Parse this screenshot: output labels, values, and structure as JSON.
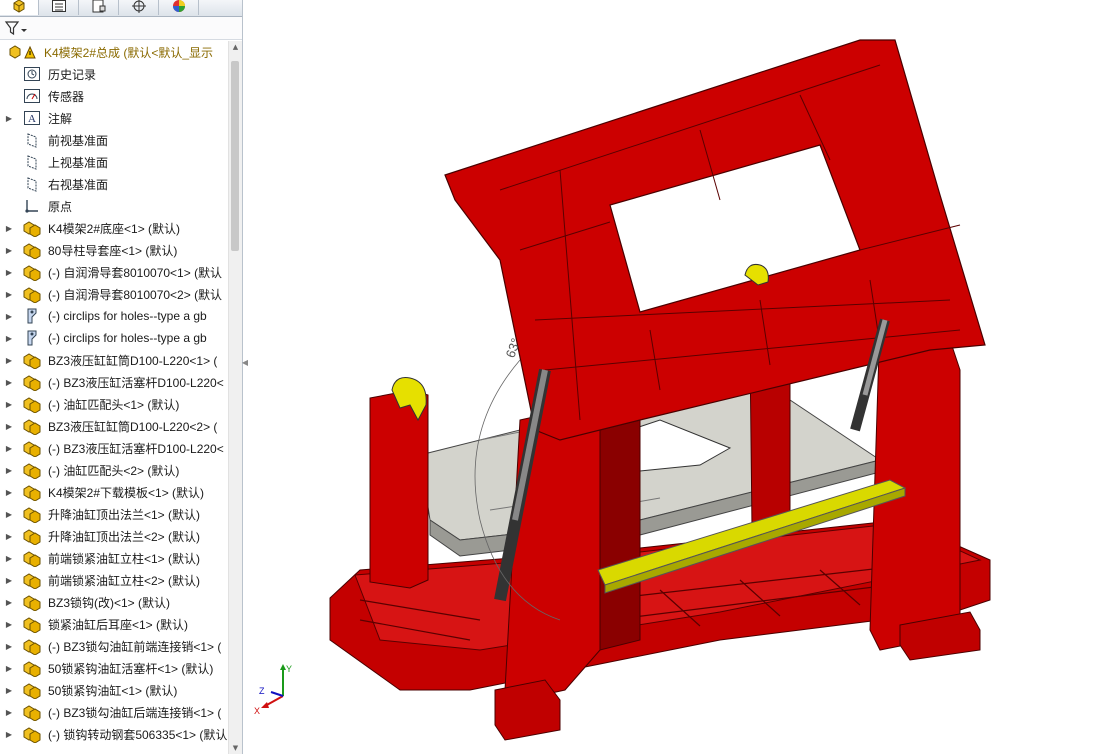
{
  "feature_manager": {
    "tabs": [
      {
        "name": "featuremanager-tab",
        "icon": "part-tree-icon"
      },
      {
        "name": "propertymanager-tab",
        "icon": "property-list-icon"
      },
      {
        "name": "configurationmanager-tab",
        "icon": "configuration-icon"
      },
      {
        "name": "dimxpert-tab",
        "icon": "crosshair-icon"
      },
      {
        "name": "display-manager-tab",
        "icon": "color-wheel-icon"
      }
    ],
    "filter_icon": "filter-icon",
    "root": {
      "label": "K4模架2#总成  (默认<默认_显示",
      "icon": "assembly-warning-icon"
    },
    "items": [
      {
        "label": "历史记录",
        "icon": "history-icon",
        "expandable": false
      },
      {
        "label": "传感器",
        "icon": "sensor-icon",
        "expandable": false
      },
      {
        "label": "注解",
        "icon": "annotation-icon",
        "expandable": true
      },
      {
        "label": "前视基准面",
        "icon": "plane-icon",
        "expandable": false
      },
      {
        "label": "上视基准面",
        "icon": "plane-icon",
        "expandable": false
      },
      {
        "label": "右视基准面",
        "icon": "plane-icon",
        "expandable": false
      },
      {
        "label": "原点",
        "icon": "origin-icon",
        "expandable": false
      },
      {
        "label": "K4模架2#底座<1> (默认)",
        "icon": "subassembly-icon",
        "expandable": true
      },
      {
        "label": "80导柱导套座<1> (默认)",
        "icon": "subassembly-icon",
        "expandable": true
      },
      {
        "label": "(-) 自润滑导套8010070<1> (默认",
        "icon": "subassembly-icon",
        "expandable": true
      },
      {
        "label": "(-) 自润滑导套8010070<2> (默认",
        "icon": "subassembly-icon",
        "expandable": true
      },
      {
        "label": "(-) circlips for holes--type a gb",
        "icon": "part-icon",
        "expandable": true
      },
      {
        "label": "(-) circlips for holes--type a gb",
        "icon": "part-icon",
        "expandable": true
      },
      {
        "label": "BZ3液压缸缸筒D100-L220<1> (",
        "icon": "subassembly-icon",
        "expandable": true
      },
      {
        "label": "(-) BZ3液压缸活塞杆D100-L220<",
        "icon": "subassembly-icon",
        "expandable": true
      },
      {
        "label": "(-) 油缸匹配头<1> (默认)",
        "icon": "subassembly-icon",
        "expandable": true
      },
      {
        "label": "BZ3液压缸缸筒D100-L220<2> (",
        "icon": "subassembly-icon",
        "expandable": true
      },
      {
        "label": "(-) BZ3液压缸活塞杆D100-L220<",
        "icon": "subassembly-icon",
        "expandable": true
      },
      {
        "label": "(-) 油缸匹配头<2> (默认)",
        "icon": "subassembly-icon",
        "expandable": true
      },
      {
        "label": "K4模架2#下载模板<1> (默认)",
        "icon": "subassembly-icon",
        "expandable": true
      },
      {
        "label": "升降油缸顶出法兰<1> (默认)",
        "icon": "subassembly-icon",
        "expandable": true
      },
      {
        "label": "升降油缸顶出法兰<2> (默认)",
        "icon": "subassembly-icon",
        "expandable": true
      },
      {
        "label": "前端锁紧油缸立柱<1> (默认)",
        "icon": "subassembly-icon",
        "expandable": true
      },
      {
        "label": "前端锁紧油缸立柱<2> (默认)",
        "icon": "subassembly-icon",
        "expandable": true
      },
      {
        "label": "BZ3锁钩(改)<1> (默认)",
        "icon": "subassembly-icon",
        "expandable": true
      },
      {
        "label": "锁紧油缸后耳座<1> (默认)",
        "icon": "subassembly-icon",
        "expandable": true
      },
      {
        "label": "(-) BZ3锁勾油缸前端连接销<1> (",
        "icon": "subassembly-icon",
        "expandable": true
      },
      {
        "label": "50锁紧钩油缸活塞杆<1> (默认)",
        "icon": "subassembly-icon",
        "expandable": true
      },
      {
        "label": "50锁紧钩油缸<1> (默认)",
        "icon": "subassembly-icon",
        "expandable": true
      },
      {
        "label": "(-) BZ3锁勾油缸后端连接销<1> (",
        "icon": "subassembly-icon",
        "expandable": true
      },
      {
        "label": "(-) 锁钩转动钢套506335<1> (默认",
        "icon": "subassembly-icon",
        "expandable": true
      }
    ]
  },
  "viewport": {
    "angle_annotation": "63°",
    "model": "tilting-mold-frame-assembly",
    "colors": {
      "frame": "#cc0000",
      "frame_dark": "#8a0000",
      "plate": "#d2d2cc",
      "rail": "#d8d800",
      "cylinder": "#555555",
      "background": "#ffffff"
    },
    "triad": {
      "x": "X",
      "y": "Y",
      "z": "Z"
    }
  }
}
